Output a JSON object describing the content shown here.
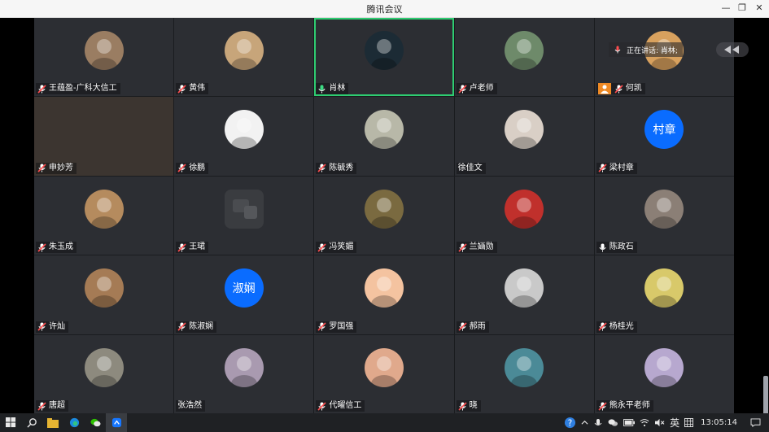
{
  "window": {
    "title": "腾讯会议"
  },
  "speaking": {
    "label": "正在讲话: 肖林;"
  },
  "participants": [
    {
      "name": "王蕴盈-广科大信工",
      "mic": "muted",
      "avatar": "photo-cat",
      "color": "#9a7d62"
    },
    {
      "name": "黄伟",
      "mic": "muted",
      "avatar": "photo-drawing",
      "color": "#c7a57a"
    },
    {
      "name": "肖林",
      "mic": "on",
      "avatar": "photo-dark",
      "color": "#1c2b35",
      "active": true
    },
    {
      "name": "卢老师",
      "mic": "muted",
      "avatar": "photo-person",
      "color": "#6e8a6a"
    },
    {
      "name": "何凯",
      "mic": "muted",
      "avatar": "photo-orange",
      "color": "#d8a15e",
      "badge": "orange"
    },
    {
      "name": "申妙芳",
      "mic": "muted",
      "avatar": "video",
      "color": "#3c3530"
    },
    {
      "name": "徐鹏",
      "mic": "muted",
      "avatar": "cartoon-man",
      "color": "#f2f2f2"
    },
    {
      "name": "陈毓秀",
      "mic": "muted",
      "avatar": "photo-sketch",
      "color": "#b8b8a8"
    },
    {
      "name": "徐佳文",
      "mic": "none",
      "avatar": "photo-girl",
      "color": "#d9cfc6"
    },
    {
      "name": "梁村章",
      "mic": "muted",
      "avatar": "text",
      "avatar_text": "村章",
      "color": "#0a6cff"
    },
    {
      "name": "朱玉成",
      "mic": "muted",
      "avatar": "photo-child",
      "color": "#b58b5e"
    },
    {
      "name": "王珺",
      "mic": "muted",
      "avatar": "placeholder",
      "color": "#3a3c40"
    },
    {
      "name": "冯笑媚",
      "mic": "muted",
      "avatar": "photo-woman",
      "color": "#7a6a40"
    },
    {
      "name": "兰婳勋",
      "mic": "muted",
      "avatar": "photo-wedding",
      "color": "#c0302c"
    },
    {
      "name": "陈政石",
      "mic": "on-white",
      "avatar": "photo-girl-red",
      "color": "#8b7f76"
    },
    {
      "name": "许灿",
      "mic": "muted",
      "avatar": "photo-coffee",
      "color": "#a57b55"
    },
    {
      "name": "陈淑娴",
      "mic": "muted",
      "avatar": "text",
      "avatar_text": "淑娴",
      "color": "#0a6cff"
    },
    {
      "name": "罗国强",
      "mic": "muted",
      "avatar": "cartoon-bear",
      "color": "#f4c3a0"
    },
    {
      "name": "郝雨",
      "mic": "muted",
      "avatar": "photo-man",
      "color": "#c9c9c9"
    },
    {
      "name": "杨桂光",
      "mic": "muted",
      "avatar": "photo-car",
      "color": "#d8c96a"
    },
    {
      "name": "唐超",
      "mic": "muted",
      "avatar": "photo-temple",
      "color": "#8d8a7e"
    },
    {
      "name": "张浩然",
      "mic": "none",
      "avatar": "photo-lady",
      "color": "#a99ab0"
    },
    {
      "name": "代曜信工",
      "mic": "muted",
      "avatar": "photo-art",
      "color": "#e0a98c"
    },
    {
      "name": "晓",
      "mic": "muted",
      "avatar": "photo-sea",
      "color": "#4b8a97"
    },
    {
      "name": "熊永平老师",
      "mic": "muted",
      "avatar": "photo-flower",
      "color": "#b7a8cf"
    }
  ],
  "taskbar": {
    "ime": "英",
    "clock": "13:05:14"
  }
}
